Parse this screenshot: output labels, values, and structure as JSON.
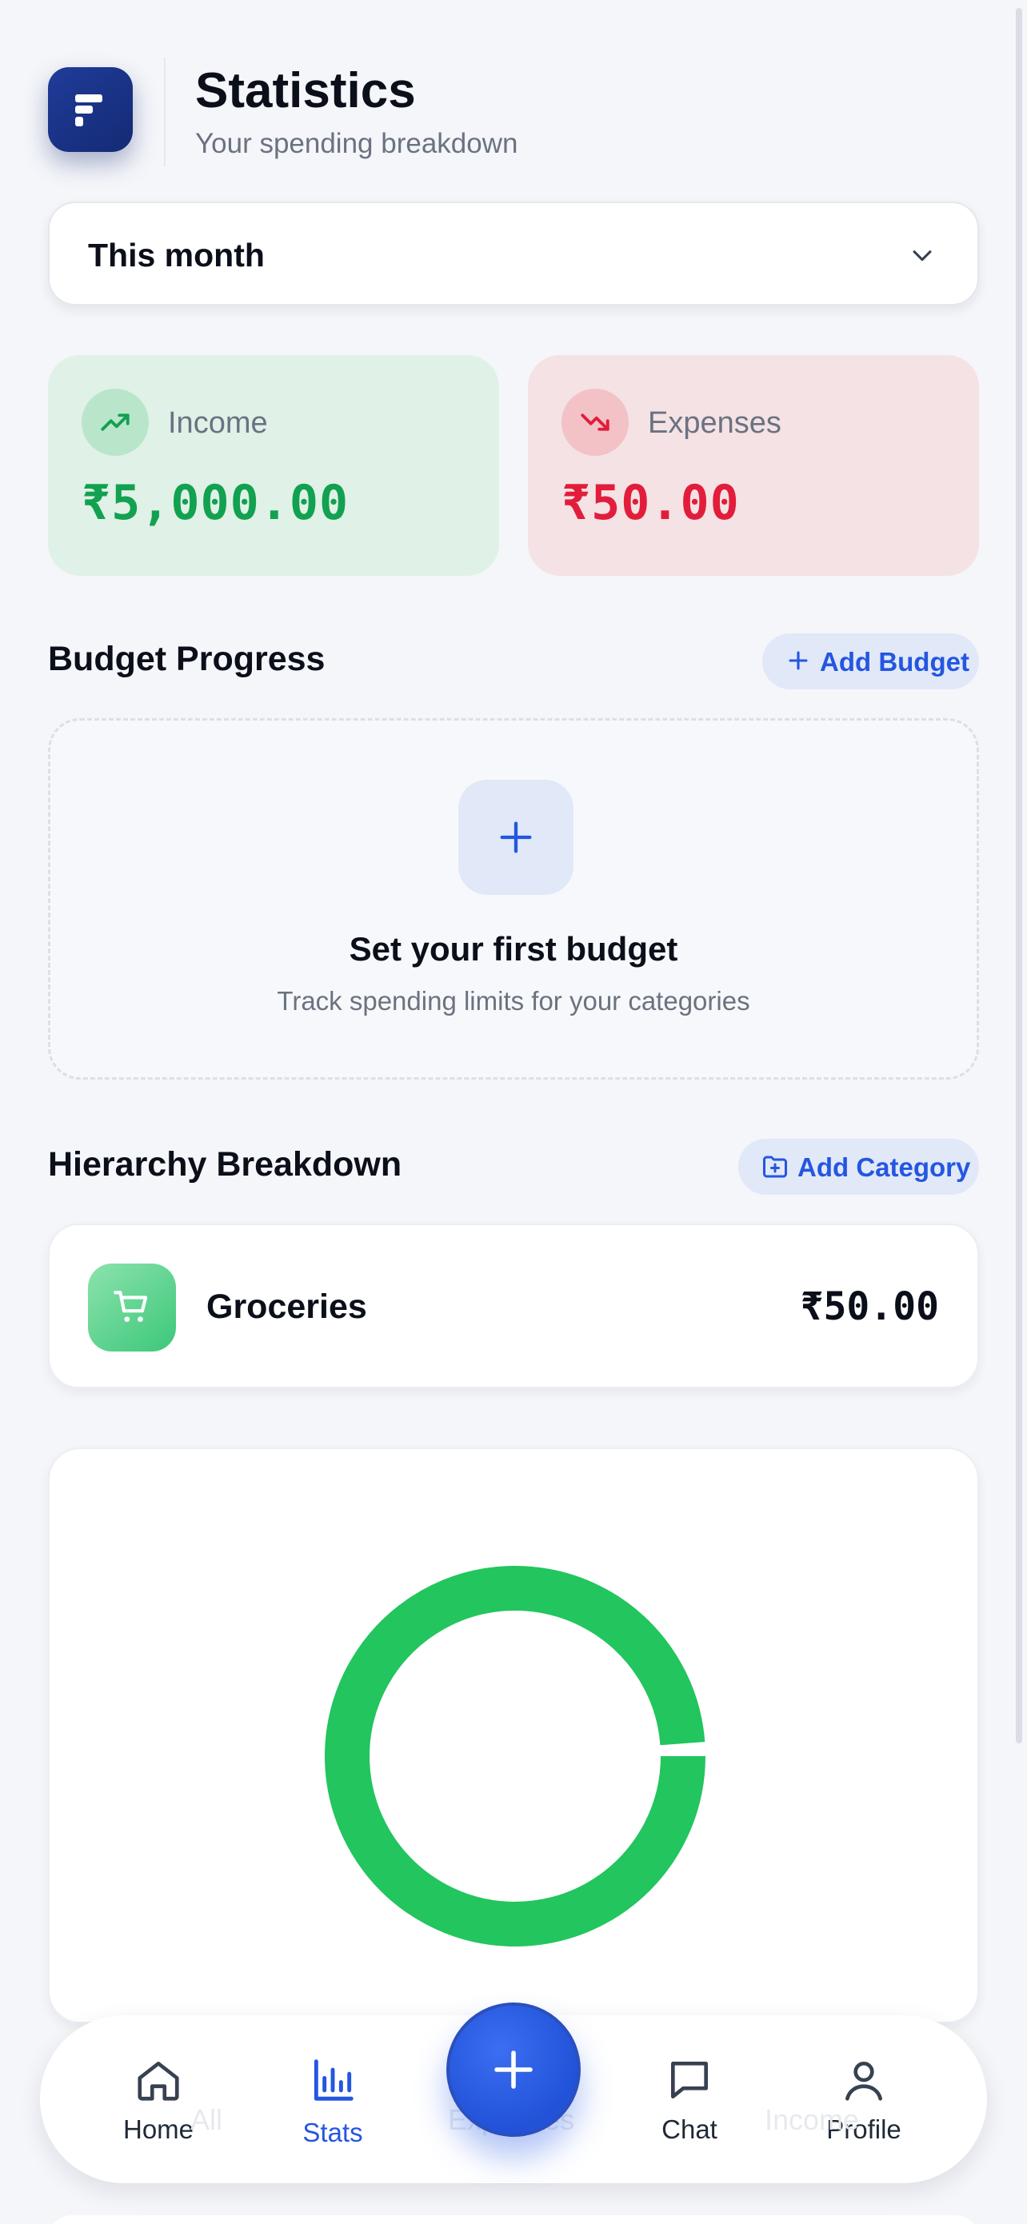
{
  "header": {
    "logo_name": "app-logo",
    "title": "Statistics",
    "subtitle": "Your spending breakdown"
  },
  "period_selector": {
    "value": "This month",
    "icon": "chevron-down-icon"
  },
  "summary": {
    "income": {
      "label": "Income",
      "amount": "₹5,000.00",
      "icon": "trending-up-icon",
      "color": "#12a150"
    },
    "expenses": {
      "label": "Expenses",
      "amount": "₹50.00",
      "icon": "trending-down-icon",
      "color": "#e21d3b"
    }
  },
  "budget": {
    "title": "Budget Progress",
    "add_label": "Add Budget",
    "empty_title": "Set your first budget",
    "empty_subtitle": "Track spending limits for your categories"
  },
  "hierarchy": {
    "title": "Hierarchy Breakdown",
    "add_label": "Add Category",
    "categories": [
      {
        "name": "Groceries",
        "amount": "₹50.00",
        "icon": "shopping-cart-icon"
      }
    ]
  },
  "chart_data": {
    "type": "pie",
    "categories": [
      "Groceries"
    ],
    "values": [
      50
    ],
    "colors": [
      "#22c55e"
    ],
    "title": ""
  },
  "ghost_filters": [
    "All",
    "Expenses",
    "Income"
  ],
  "nav": {
    "items": [
      {
        "label": "Home",
        "icon": "home-icon",
        "active": false
      },
      {
        "label": "Stats",
        "icon": "bar-chart-icon",
        "active": true
      },
      {
        "label": "Chat",
        "icon": "chat-icon",
        "active": false
      },
      {
        "label": "Profile",
        "icon": "user-icon",
        "active": false
      }
    ],
    "fab_icon": "plus-icon"
  },
  "colors": {
    "accent": "#2456e0",
    "background": "#f5f6fa"
  }
}
